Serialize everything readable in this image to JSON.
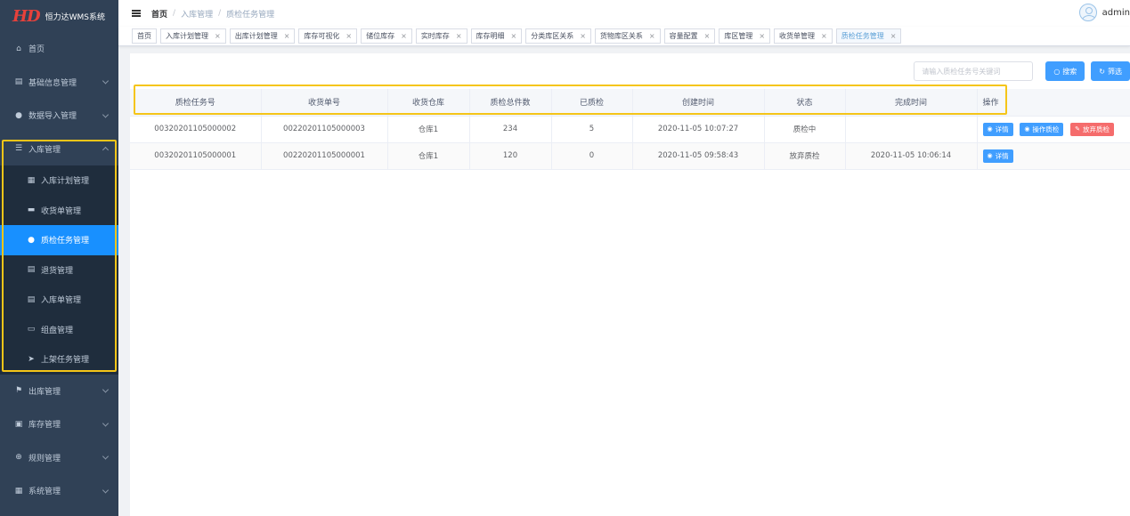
{
  "app": {
    "logo_mark": "HD",
    "title": "恒力达WMS系统"
  },
  "sidebar": {
    "top_items": [
      {
        "label": "首页",
        "icon": "home-icon"
      },
      {
        "label": "基础信息管理",
        "icon": "clipboard-icon"
      },
      {
        "label": "数据导入管理",
        "icon": "user-icon"
      }
    ],
    "group": {
      "label": "入库管理",
      "icon": "list-icon",
      "items": [
        {
          "label": "入库计划管理",
          "icon": "grid-icon"
        },
        {
          "label": "收货单管理",
          "icon": "truck-icon"
        },
        {
          "label": "质检任务管理",
          "icon": "person-icon",
          "active": true
        },
        {
          "label": "退货管理",
          "icon": "clipboard-icon"
        },
        {
          "label": "入库单管理",
          "icon": "clipboard-icon"
        },
        {
          "label": "组盘管理",
          "icon": "monitor-icon"
        },
        {
          "label": "上架任务管理",
          "icon": "send-icon"
        }
      ]
    },
    "bottom_items": [
      {
        "label": "出库管理",
        "icon": "flag-icon"
      },
      {
        "label": "库存管理",
        "icon": "chart-icon"
      },
      {
        "label": "规则管理",
        "icon": "plus-circle-icon"
      },
      {
        "label": "系统管理",
        "icon": "grid-icon"
      }
    ]
  },
  "header": {
    "breadcrumb": [
      "首页",
      "入库管理",
      "质检任务管理"
    ],
    "username": "admin"
  },
  "tags": [
    {
      "label": "首页",
      "closable": false
    },
    {
      "label": "入库计划管理",
      "closable": true
    },
    {
      "label": "出库计划管理",
      "closable": true
    },
    {
      "label": "库存可视化",
      "closable": true
    },
    {
      "label": "储位库存",
      "closable": true
    },
    {
      "label": "实时库存",
      "closable": true
    },
    {
      "label": "库存明细",
      "closable": true
    },
    {
      "label": "分类库区关系",
      "closable": true
    },
    {
      "label": "货物库区关系",
      "closable": true
    },
    {
      "label": "容量配置",
      "closable": true
    },
    {
      "label": "库区管理",
      "closable": true
    },
    {
      "label": "收货单管理",
      "closable": true
    },
    {
      "label": "质检任务管理",
      "closable": true,
      "active": true
    }
  ],
  "toolbar": {
    "search_placeholder": "请输入质检任务号关键词",
    "search_label": "搜索",
    "filter_label": "筛选"
  },
  "table": {
    "columns": [
      "质检任务号",
      "收货单号",
      "收货仓库",
      "质检总件数",
      "已质检",
      "创建时间",
      "状态",
      "完成时间",
      "操作"
    ],
    "rows": [
      {
        "cells": [
          "00320201105000002",
          "00220201105000003",
          "仓库1",
          "234",
          "5",
          "2020-11-05 10:07:27",
          "质检中",
          ""
        ],
        "actions": [
          "详情",
          "操作质检",
          "放弃质检"
        ]
      },
      {
        "cells": [
          "00320201105000001",
          "00220201105000001",
          "仓库1",
          "120",
          "0",
          "2020-11-05 09:58:43",
          "放弃质检",
          "2020-11-05 10:06:14"
        ],
        "actions": [
          "详情"
        ]
      }
    ]
  },
  "colors": {
    "sidebar_bg": "#304156",
    "active_blue": "#1890ff",
    "primary": "#409eff",
    "danger": "#f56c6c",
    "highlight": "#f5c518"
  }
}
